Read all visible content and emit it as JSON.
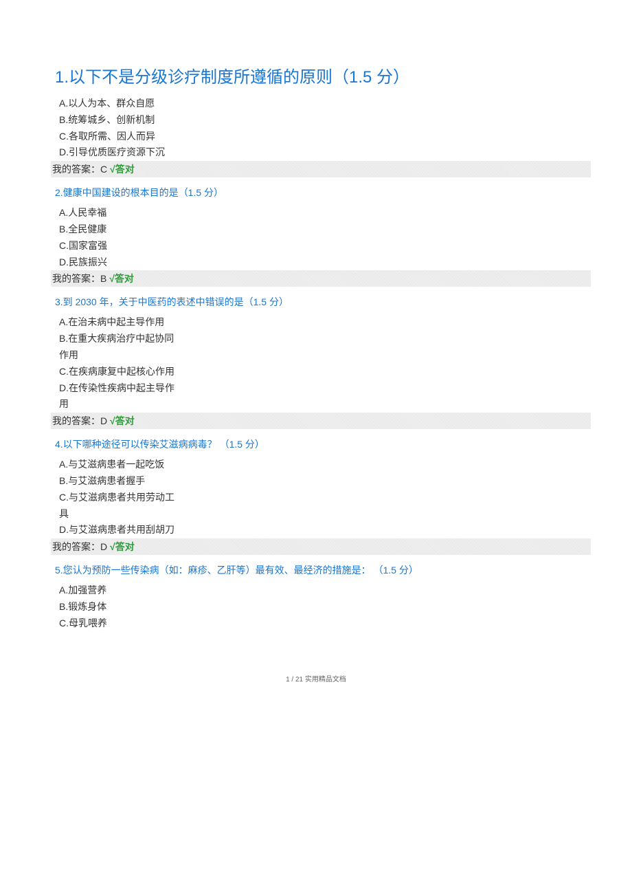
{
  "questions": [
    {
      "number": "1",
      "title_prefix": "1.以下不是分级诊疗制度所遵循的原则",
      "points": "（1.5 分）",
      "options": [
        "A.以人为本、群众自愿",
        "B.统筹城乡、创新机制",
        "C.各取所需、因人而异",
        "D.引导优质医疗资源下沉"
      ],
      "answer_label": "我的答案：",
      "answer_letter": "C",
      "check_mark": "√",
      "check_text": "答对"
    },
    {
      "number": "2",
      "title_prefix": "2.健康中国建设的根本目的是",
      "points": "（1.5 分）",
      "options": [
        "A.人民幸福",
        "B.全民健康",
        "C.国家富强",
        "D.民族振兴"
      ],
      "answer_label": "我的答案：",
      "answer_letter": "B",
      "check_mark": "√",
      "check_text": "答对"
    },
    {
      "number": "3",
      "title_prefix": "3.到 2030 年，关于中医药的表述中错误的是",
      "points": "（1.5 分）",
      "options": [
        "A.在治未病中起主导作用",
        "B.在重大疾病治疗中起协同作用",
        "C.在疾病康复中起核心作用",
        "D.在传染性疾病中起主导作用"
      ],
      "answer_label": "我的答案：",
      "answer_letter": "D",
      "check_mark": "√",
      "check_text": "答对"
    },
    {
      "number": "4",
      "title_prefix": "4.以下哪种途径可以传染艾滋病病毒？",
      "points": "（1.5 分）",
      "options": [
        "A.与艾滋病患者一起吃饭",
        "B.与艾滋病患者握手",
        "C.与艾滋病患者共用劳动工具",
        "D.与艾滋病患者共用刮胡刀"
      ],
      "answer_label": "我的答案：",
      "answer_letter": "D",
      "check_mark": "√",
      "check_text": "答对"
    },
    {
      "number": "5",
      "title_prefix": "5.您认为预防一些传染病（如：麻疹、乙肝等）最有效、最经济的措施是：",
      "points": "（1.5 分）",
      "options": [
        "A.加强营养",
        "B.锻炼身体",
        "C.母乳喂养"
      ],
      "answer_label": "",
      "answer_letter": "",
      "check_mark": "",
      "check_text": ""
    }
  ],
  "footer": "1 / 21 实用精品文档"
}
